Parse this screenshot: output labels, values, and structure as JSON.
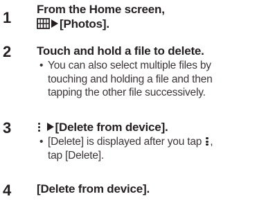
{
  "steps": [
    {
      "number": "1",
      "line1": "From the Home screen,",
      "line2_text": "[Photos].",
      "line2_icons": [
        "apps-grid-icon",
        "right-triangle-icon"
      ]
    },
    {
      "number": "2",
      "title": "Touch and hold a file to delete.",
      "note": {
        "bullet": "•",
        "lines": [
          "You can also select multiple files by",
          "touching and holding a file and then",
          "tapping the other file successively."
        ]
      }
    },
    {
      "number": "3",
      "title_text": "[Delete from device].",
      "title_icons": [
        "more-vertical-icon",
        "right-triangle-icon"
      ],
      "note": {
        "bullet": "•",
        "line1_before": "[Delete] is displayed after  you tap",
        "line1_after": ",",
        "line2": "tap [Delete]."
      }
    },
    {
      "number": "4",
      "title": "[Delete from device]."
    }
  ]
}
